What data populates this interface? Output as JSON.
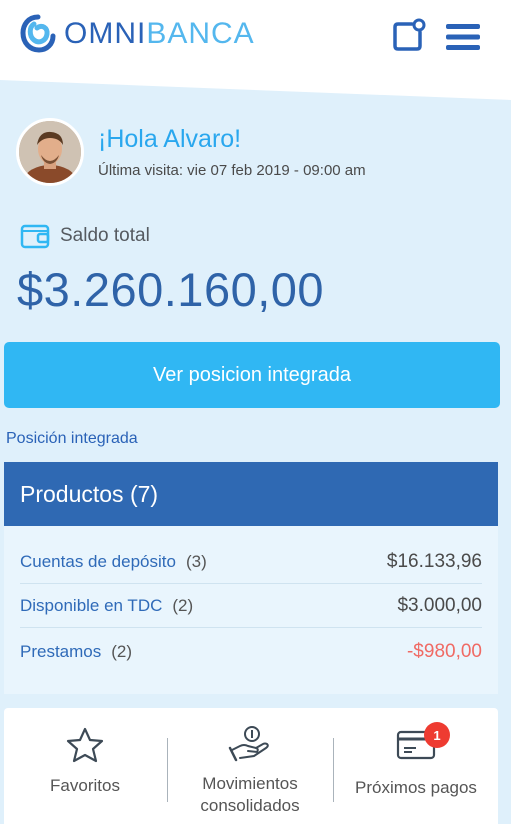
{
  "brand": {
    "name_part1": "OMNI",
    "name_part2": "BANCA"
  },
  "header": {
    "icons": [
      "new-message-icon",
      "hamburger-menu-icon"
    ]
  },
  "greeting": {
    "hello": "¡Hola Alvaro!",
    "last_visit": "Última visita: vie 07 feb 2019 - 09:00 am"
  },
  "balance": {
    "label": "Saldo total",
    "amount": "$3.260.160,00",
    "icon": "wallet-icon"
  },
  "cta": {
    "label": "Ver posicion integrada"
  },
  "position": {
    "title": "Posición integrada",
    "products_header": "Productos (7)",
    "products": [
      {
        "name": "Cuentas de depósito",
        "count": "(3)",
        "value": "$16.133,96",
        "negative": false
      },
      {
        "name": "Disponible en TDC",
        "count": "(2)",
        "value": "$3.000,00",
        "negative": false
      },
      {
        "name": "Prestamos",
        "count": "(2)",
        "value": "-$980,00",
        "negative": true
      }
    ]
  },
  "bottom_nav": {
    "items": [
      {
        "label": "Favoritos",
        "icon": "star-icon"
      },
      {
        "label": "Movimientos consolidados",
        "icon": "money-hand-icon"
      },
      {
        "label": "Próximos pagos",
        "icon": "credit-card-icon",
        "badge": "1"
      }
    ]
  },
  "colors": {
    "brand_dark": "#2a62b7",
    "brand_light": "#30b7f3",
    "negative": "#f06a64",
    "background": "#dff0fb"
  }
}
